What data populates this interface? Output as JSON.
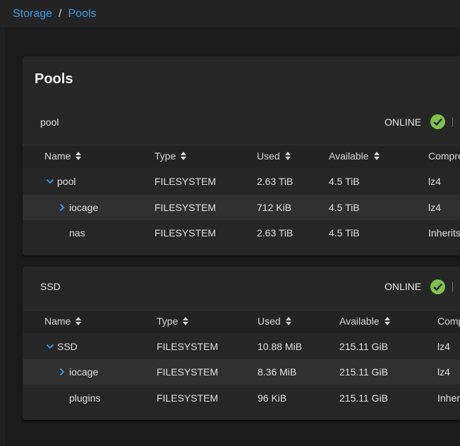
{
  "breadcrumb": {
    "parent": "Storage",
    "separator": "/",
    "current": "Pools"
  },
  "page_title": "Pools",
  "colors": {
    "accent": "#3d9be3",
    "status_ok": "#7dc24b"
  },
  "columns": [
    "Name",
    "Type",
    "Used",
    "Available",
    "Compre"
  ],
  "pools": [
    {
      "name": "pool",
      "status": "ONLINE",
      "columns": [
        "Name",
        "Type",
        "Used",
        "Available",
        "Compre"
      ],
      "rows": [
        {
          "name": "pool",
          "expander": "chevron-down",
          "type": "FILESYSTEM",
          "used": "2.63 TiB",
          "available": "4.5 TiB",
          "compression": "lz4"
        },
        {
          "name": "iocage",
          "expander": "chevron-right",
          "type": "FILESYSTEM",
          "used": "712 KiB",
          "available": "4.5 TiB",
          "compression": "lz4"
        },
        {
          "name": "nas",
          "expander": "",
          "type": "FILESYSTEM",
          "used": "2.63 TiB",
          "available": "4.5 TiB",
          "compression": "Inherits"
        }
      ]
    },
    {
      "name": "SSD",
      "status": "ONLINE",
      "columns": [
        "Name",
        "Type",
        "Used",
        "Available",
        "Comp"
      ],
      "rows": [
        {
          "name": "SSD",
          "expander": "chevron-down",
          "type": "FILESYSTEM",
          "used": "10.88 MiB",
          "available": "215.11 GiB",
          "compression": "lz4"
        },
        {
          "name": "iocage",
          "expander": "chevron-right",
          "type": "FILESYSTEM",
          "used": "8.36 MiB",
          "available": "215.11 GiB",
          "compression": "lz4"
        },
        {
          "name": "plugins",
          "expander": "",
          "type": "FILESYSTEM",
          "used": "96 KiB",
          "available": "215.11 GiB",
          "compression": "Inher"
        }
      ]
    }
  ]
}
